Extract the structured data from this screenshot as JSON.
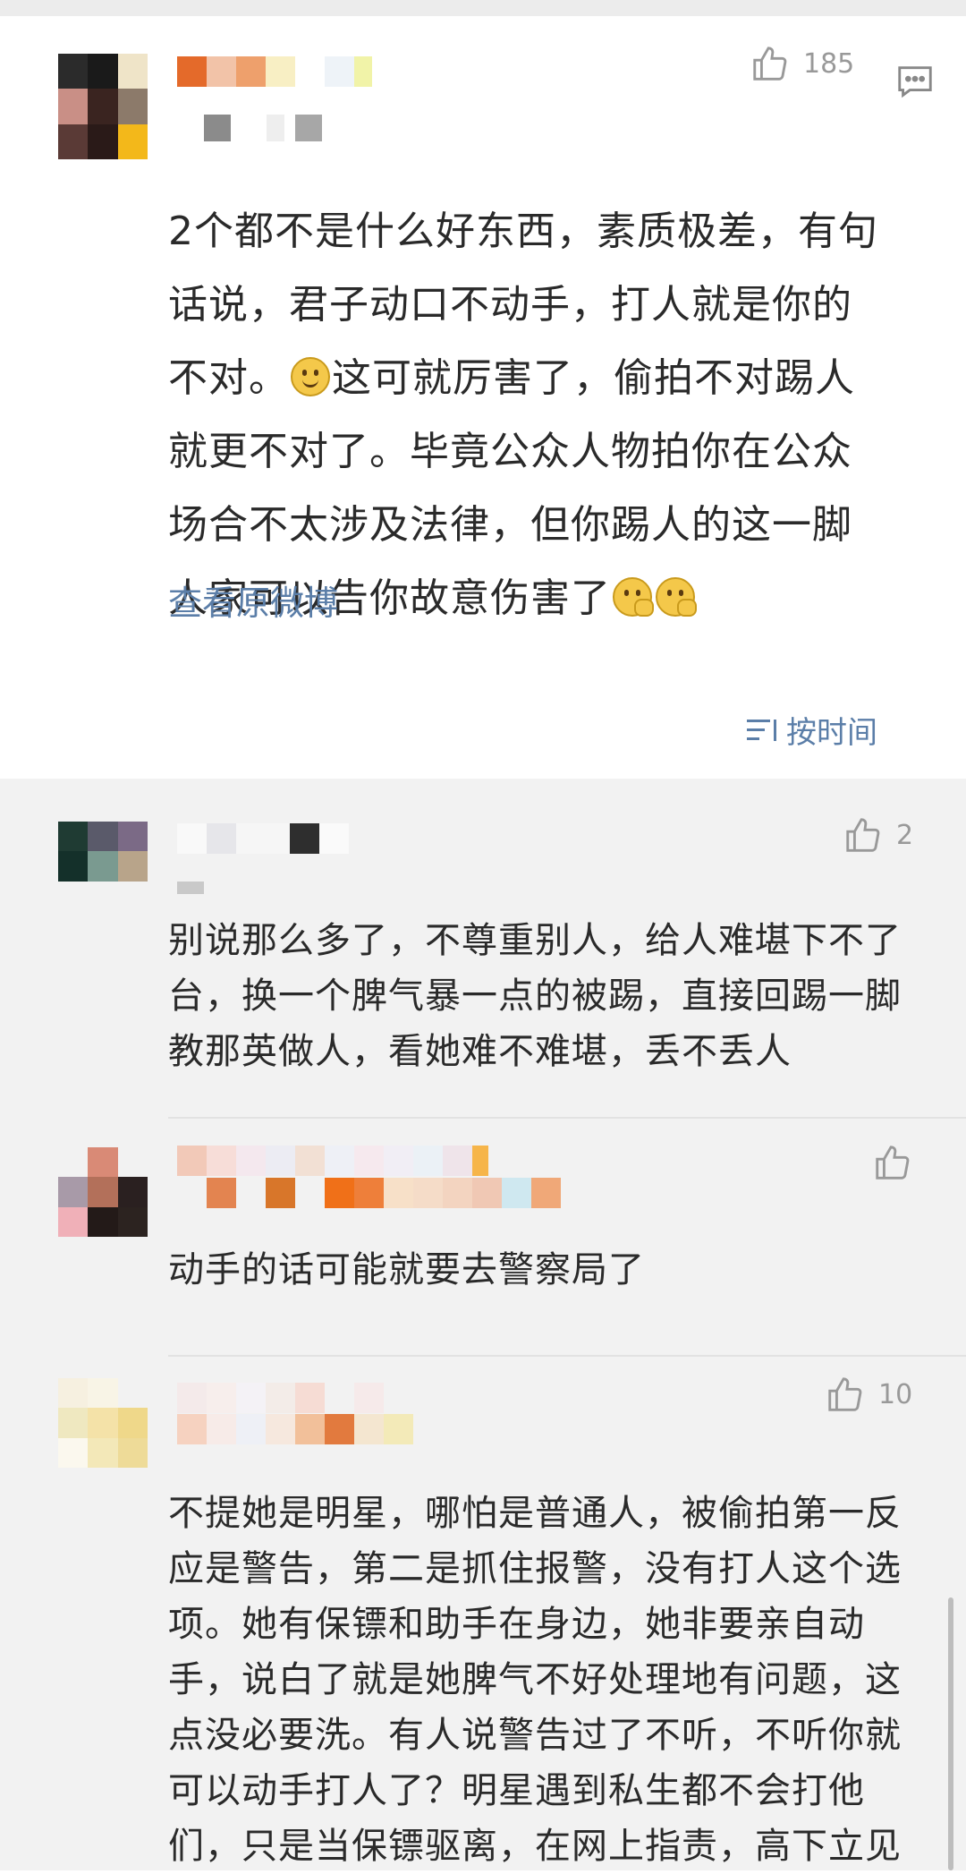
{
  "main_comment": {
    "likes": "185",
    "text_lines": [
      "2个都不是什么好东西，素质极差，有句",
      "话说，君子动口不动手，打人就是你的",
      "不对。",
      "这可就厉害了，偷拍不对踢人",
      "就更不对了。毕竟公众人物拍你在公众",
      "场合不太涉及法律，但你踢人的这一脚",
      "人家可以告你故意伤害了"
    ],
    "view_original_label": "查看原微博",
    "sort_label": "按时间"
  },
  "replies": [
    {
      "likes": "2",
      "text": "别说那么多了，不尊重别人，给人难堪下不了台，换一个脾气暴一点的被踢，直接回踢一脚教那英做人，看她难不难堪，丢不丢人"
    },
    {
      "likes": "",
      "text": "动手的话可能就要去警察局了"
    },
    {
      "likes": "10",
      "text": "不提她是明星，哪怕是普通人，被偷拍第一反应是警告，第二是抓住报警，没有打人这个选项。她有保镖和助手在身边，她非要亲自动手，说白了就是她脾气不好处理地有问题，这点没必要洗。有人说警告过了不听，不听你就可以动手打人了？明星遇到私生都不会打他们，只是当保镖驱离，在网上指责，高下立见"
    }
  ],
  "icons": [
    "thumbs-up-icon",
    "comment-icon",
    "sort-icon",
    "smile-emoji",
    "think-emoji"
  ],
  "colors": {
    "link": "#5b7ea8",
    "replies_bg": "#f2f2f2",
    "icon_grey": "#999999"
  }
}
